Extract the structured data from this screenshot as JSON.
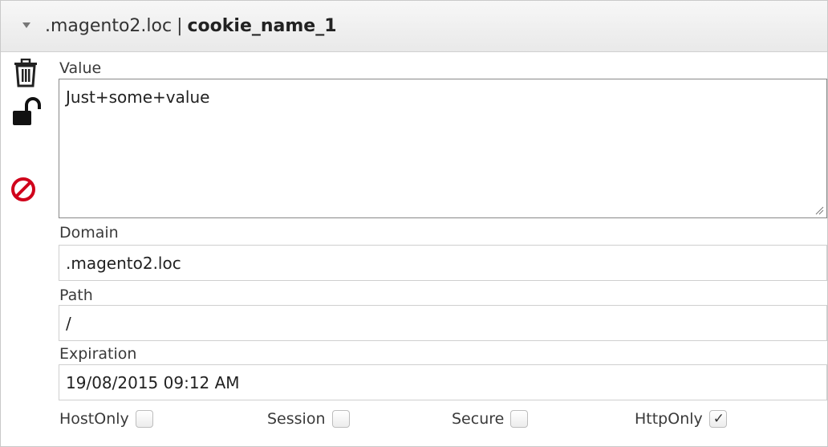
{
  "header": {
    "domain": ".magento2.loc",
    "separator": "|",
    "cookie_name": "cookie_name_1"
  },
  "sidebar_icons": [
    "trash-icon",
    "unlock-icon",
    "block-icon"
  ],
  "colors": {
    "block_icon": "#d0021b",
    "header_bg": "#efefef"
  },
  "form": {
    "value_label": "Value",
    "value": "Just+some+value",
    "domain_label": "Domain",
    "domain": ".magento2.loc",
    "path_label": "Path",
    "path": "/",
    "expiration_label": "Expiration",
    "expiration": "19/08/2015 09:12 AM"
  },
  "flags": {
    "hostonly_label": "HostOnly",
    "hostonly": false,
    "session_label": "Session",
    "session": false,
    "secure_label": "Secure",
    "secure": false,
    "httponly_label": "HttpOnly",
    "httponly": true,
    "check_glyph": "✓"
  }
}
